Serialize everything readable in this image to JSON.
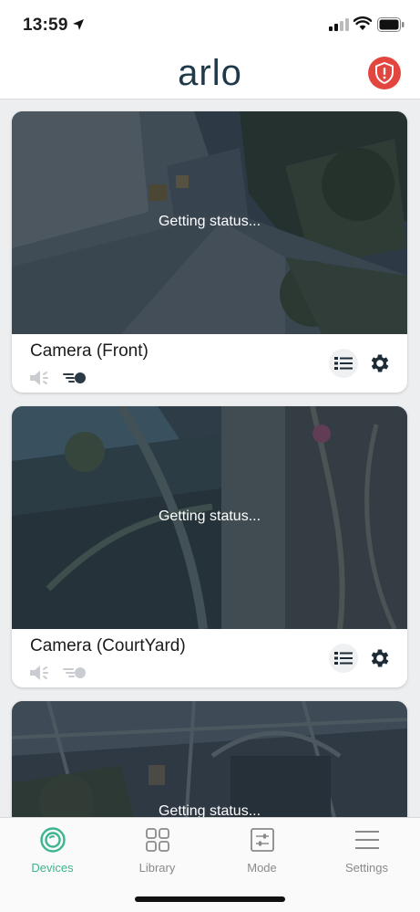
{
  "status_bar": {
    "time": "13:59"
  },
  "header": {
    "logo": "arlo",
    "alert_symbol": "!"
  },
  "cameras": [
    {
      "name": "Camera (Front)",
      "status": "Getting status..."
    },
    {
      "name": "Camera (CourtYard)",
      "status": "Getting status..."
    },
    {
      "name": "",
      "status": "Getting status..."
    }
  ],
  "tabs": [
    {
      "label": "Devices",
      "icon": "devices-icon",
      "active": true
    },
    {
      "label": "Library",
      "icon": "library-grid-icon"
    },
    {
      "label": "Mode",
      "icon": "mode-sliders-icon"
    },
    {
      "label": "Settings",
      "icon": "settings-menu-icon"
    }
  ],
  "colors": {
    "accent": "#3bb58f",
    "alert": "#e3453f",
    "logo": "#1f3a4a"
  }
}
